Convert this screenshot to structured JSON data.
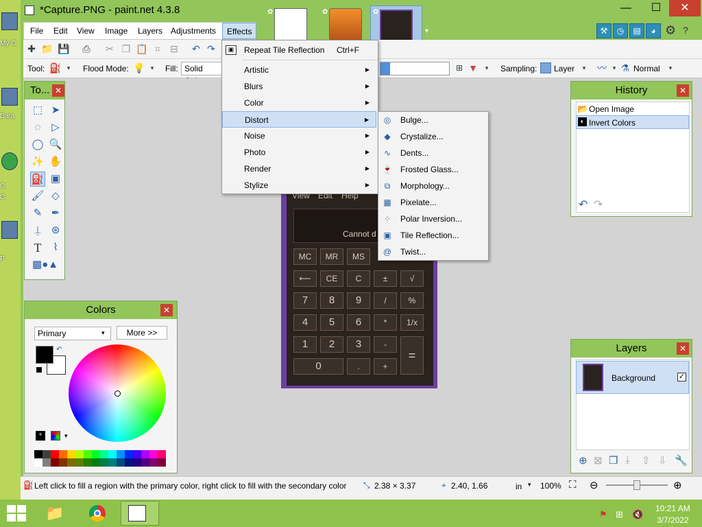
{
  "window": {
    "title": "*Capture.PNG - paint.net 4.3.8",
    "minimize": "—",
    "maximize": "☐",
    "close": "✕"
  },
  "desktop": {
    "labels": [
      "My C",
      "Data",
      "C",
      "C",
      "P"
    ]
  },
  "menubar": {
    "items": [
      "File",
      "Edit",
      "View",
      "Image",
      "Layers",
      "Adjustments",
      "Effects"
    ],
    "open_item": "Effects"
  },
  "effects_menu": {
    "repeat": {
      "label": "Repeat Tile Reflection",
      "shortcut": "Ctrl+F"
    },
    "items": [
      "Artistic",
      "Blurs",
      "Color",
      "Distort",
      "Noise",
      "Photo",
      "Render",
      "Stylize"
    ],
    "highlighted": "Distort"
  },
  "distort_submenu": {
    "items": [
      {
        "label": "Bulge...",
        "icon": "bulge-icon",
        "glyph": "◎"
      },
      {
        "label": "Crystalize...",
        "icon": "crystalize-icon",
        "glyph": "◆"
      },
      {
        "label": "Dents...",
        "icon": "dents-icon",
        "glyph": "∿"
      },
      {
        "label": "Frosted Glass...",
        "icon": "frosted-glass-icon",
        "glyph": "🍷"
      },
      {
        "label": "Morphology...",
        "icon": "morphology-icon",
        "glyph": "⧉"
      },
      {
        "label": "Pixelate...",
        "icon": "pixelate-icon",
        "glyph": "▦"
      },
      {
        "label": "Polar Inversion...",
        "icon": "polar-inversion-icon",
        "glyph": "⁘"
      },
      {
        "label": "Tile Reflection...",
        "icon": "tile-reflection-icon",
        "glyph": "▣"
      },
      {
        "label": "Twist...",
        "icon": "twist-icon",
        "glyph": "@"
      }
    ]
  },
  "toolbar2": {
    "tool_label": "Tool:",
    "flood_label": "Flood Mode:",
    "fill_label": "Fill:",
    "fill_value": "Solid Colo",
    "sampling_label": "Sampling:",
    "sampling_value": "Layer",
    "blend_value": "Normal"
  },
  "tools_panel": {
    "title": "To..."
  },
  "history_panel": {
    "title": "History",
    "items": [
      "Open Image",
      "Invert Colors"
    ],
    "selected": "Invert Colors"
  },
  "layers_panel": {
    "title": "Layers",
    "layer_name": "Background"
  },
  "colors_panel": {
    "title": "Colors",
    "mode": "Primary",
    "more": "More >>"
  },
  "calculator": {
    "menu": [
      "View",
      "Edit",
      "Help"
    ],
    "display": "Cannot d",
    "rows": [
      [
        "MC",
        "MR",
        "MS"
      ],
      [
        "⟵",
        "CE",
        "C",
        "±",
        "√"
      ],
      [
        "7",
        "8",
        "9",
        "/",
        "%"
      ],
      [
        "4",
        "5",
        "6",
        "*",
        "1/x"
      ],
      [
        "1",
        "2",
        "3",
        "-",
        "="
      ],
      [
        "0",
        ".",
        "+"
      ]
    ]
  },
  "statusbar": {
    "hint": "Left click to fill a region with the primary color, right click to fill with the secondary color",
    "size": "2.38 × 3.37",
    "position": "2.40, 1.66",
    "unit": "in",
    "zoom": "100%"
  },
  "taskbar": {
    "time": "10:21 AM",
    "date": "3/7/2022"
  },
  "colors": {
    "accent": "#92c55a",
    "close": "#c8412f",
    "highlight": "#cfe0f5"
  }
}
